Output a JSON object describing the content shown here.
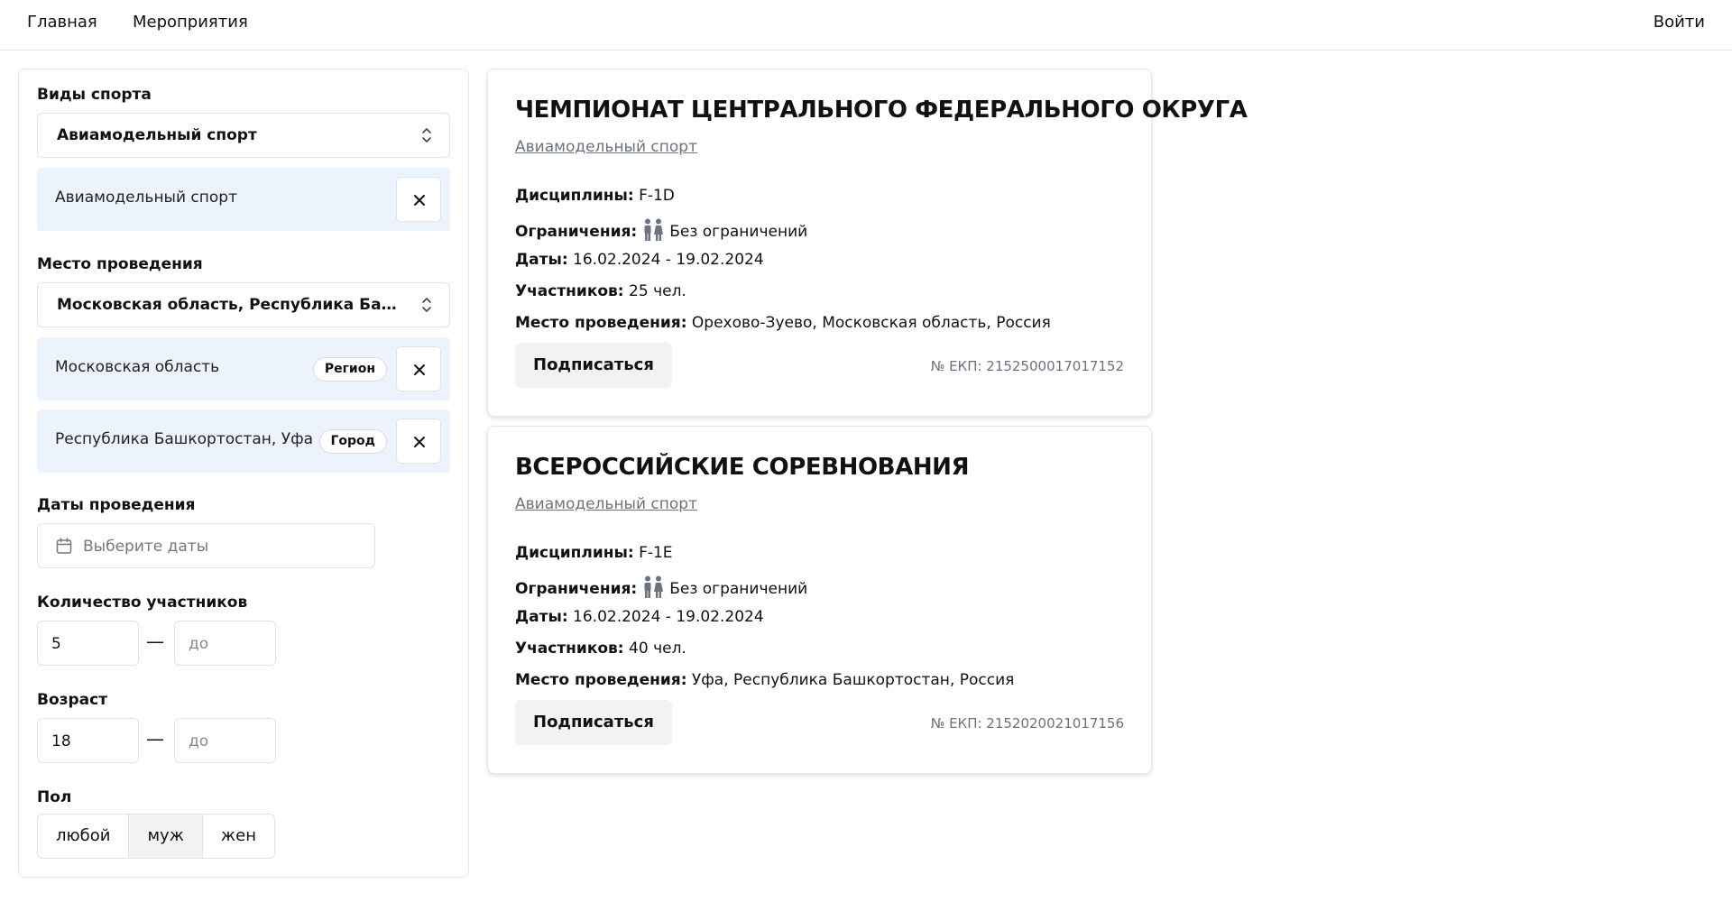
{
  "nav": {
    "home": "Главная",
    "events": "Мероприятия",
    "login": "Войти"
  },
  "filters": {
    "sport": {
      "label": "Виды спорта",
      "selected": "Авиамодельный спорт",
      "chips": [
        {
          "text": "Авиамодельный спорт"
        }
      ]
    },
    "location": {
      "label": "Место проведения",
      "selected": "Московская область, Республика Башкортостан, Уфа",
      "chips": [
        {
          "text": "Московская область",
          "badge": "Регион"
        },
        {
          "text": "Республика Башкортостан, Уфа",
          "badge": "Город"
        }
      ]
    },
    "dates": {
      "label": "Даты проведения",
      "placeholder": "Выберите даты"
    },
    "participants": {
      "label": "Количество участников",
      "from": "5",
      "to_placeholder": "до"
    },
    "age": {
      "label": "Возраст",
      "from": "18",
      "to_placeholder": "до"
    },
    "gender": {
      "label": "Пол",
      "options": [
        "любой",
        "муж",
        "жен"
      ],
      "selected": "муж"
    }
  },
  "labels": {
    "disciplines": "Дисциплины:",
    "restrictions": "Ограничения:",
    "dates": "Даты:",
    "participants": "Участников:",
    "location": "Место проведения:",
    "subscribe": "Подписаться"
  },
  "events": [
    {
      "title": "ЧЕМПИОНАТ ЦЕНТРАЛЬНОГО ФЕДЕРАЛЬНОГО ОКРУГА",
      "sport": "Авиамодельный спорт",
      "disciplines": "F-1D",
      "restrictions": "Без ограничений",
      "dates": "16.02.2024 - 19.02.2024",
      "participants": "25 чел.",
      "location": "Орехово-Зуево, Московская область, Россия",
      "ekp": "№ ЕКП: 2152500017017152"
    },
    {
      "title": "ВСЕРОССИЙСКИЕ СОРЕВНОВАНИЯ",
      "sport": "Авиамодельный спорт",
      "disciplines": "F-1E",
      "restrictions": "Без ограничений",
      "dates": "16.02.2024 - 19.02.2024",
      "participants": "40 чел.",
      "location": "Уфа, Республика Башкортостан, Россия",
      "ekp": "№ ЕКП: 2152020021017156"
    }
  ]
}
